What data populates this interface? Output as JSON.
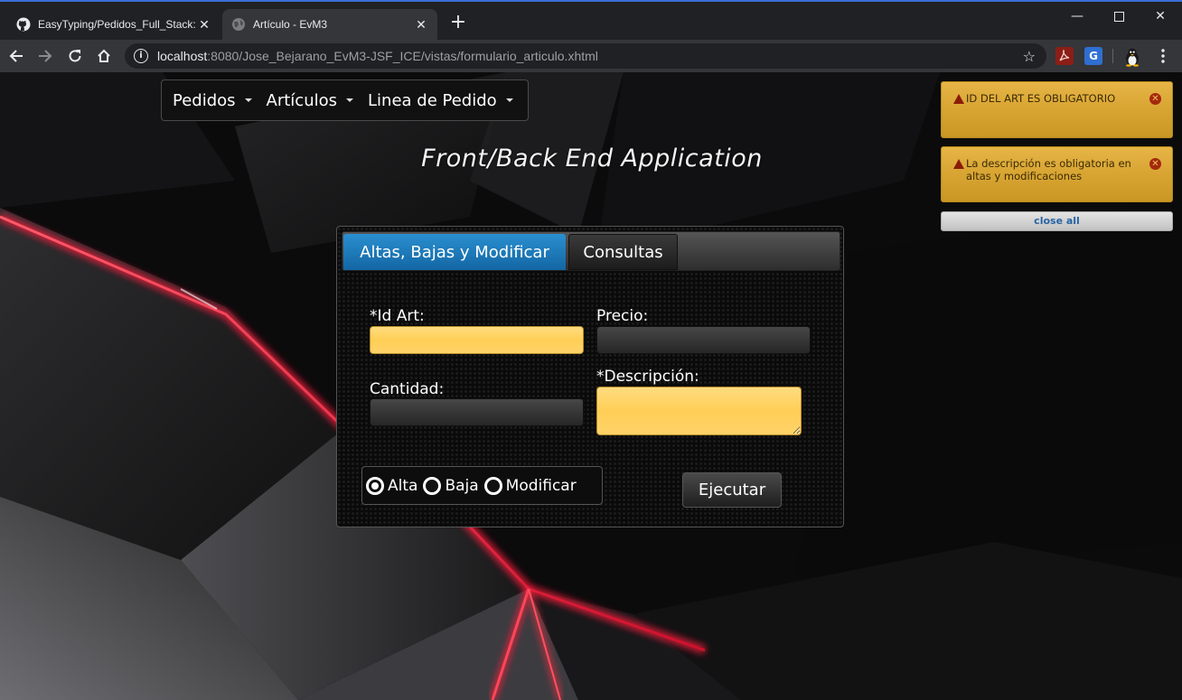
{
  "browser": {
    "tabs": [
      {
        "title": "EasyTyping/Pedidos_Full_Stack: A",
        "icon": "github-icon",
        "active": false
      },
      {
        "title": "Artículo - EvM3",
        "icon": "globe-icon",
        "active": true
      }
    ],
    "new_tab_label": "+",
    "url_host": "localhost",
    "url_rest": ":8080/Jose_Bejarano_EvM3-JSF_ICE/vistas/formulario_articulo.xhtml",
    "window_controls": [
      "minimize",
      "maximize",
      "close"
    ]
  },
  "menubar": {
    "items": [
      {
        "label": "Pedidos"
      },
      {
        "label": "Artículos"
      },
      {
        "label": "Linea de Pedido"
      }
    ]
  },
  "app_title": "Front/Back End Application",
  "form": {
    "tabs": [
      {
        "label": "Altas, Bajas y Modificar",
        "active": true
      },
      {
        "label": "Consultas",
        "active": false
      }
    ],
    "fields": {
      "id_art": {
        "label": "*Id Art:",
        "value": "",
        "required_error": true
      },
      "precio": {
        "label": "Precio:",
        "value": ""
      },
      "cantidad": {
        "label": "Cantidad:",
        "value": ""
      },
      "descripcion": {
        "label": "*Descripción:",
        "value": "",
        "required_error": true
      }
    },
    "operation": {
      "options": [
        "Alta",
        "Baja",
        "Modificar"
      ],
      "selected": "Alta"
    },
    "execute_label": "Ejecutar"
  },
  "messages": {
    "items": [
      {
        "text": "ID DEL ART ES OBLIGATORIO",
        "severity": "warn"
      },
      {
        "text": "La descripción es obligatoria en altas y modificaciones",
        "severity": "warn"
      }
    ],
    "close_all_label": "close all"
  },
  "colors": {
    "active_tab": "#1f7fc0",
    "required_field": "#ffd15e",
    "growl_warn": "#dcaa38",
    "accent_red": "#ff2a4a"
  }
}
